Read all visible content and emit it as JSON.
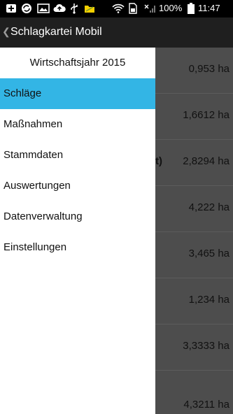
{
  "status_bar": {
    "icons": [
      "add-box-icon",
      "sync-icon",
      "image-icon",
      "cloud-upload-icon",
      "usb-icon",
      "folder-icon",
      "wifi-icon",
      "sim-icon",
      "signal-icon"
    ],
    "battery": "100%",
    "time": "11:47"
  },
  "action_bar": {
    "title": "Schlagkartei Mobil"
  },
  "drawer": {
    "fiscal_year": "Wirtschaftsjahr 2015",
    "items": [
      {
        "label": "Schläge",
        "active": true
      },
      {
        "label": "Maßnahmen",
        "active": false
      },
      {
        "label": "Stammdaten",
        "active": false
      },
      {
        "label": "Auswertungen",
        "active": false
      },
      {
        "label": "Datenverwaltung",
        "active": false
      },
      {
        "label": "Einstellungen",
        "active": false
      }
    ]
  },
  "list": {
    "rows": [
      {
        "area": "0,953 ha",
        "fragment": ""
      },
      {
        "area": "1,6612 ha",
        "fragment": ""
      },
      {
        "area": "2,8294 ha",
        "fragment": "t)"
      },
      {
        "area": "4,222 ha",
        "fragment": ""
      },
      {
        "area": "3,465 ha",
        "fragment": ""
      },
      {
        "area": "1,234 ha",
        "fragment": ""
      },
      {
        "area": "3,3333 ha",
        "fragment": ""
      },
      {
        "area": "4,3211 ha",
        "fragment": ""
      }
    ]
  },
  "colors": {
    "accent": "#33b5e5",
    "action_bar": "#1f1f1f",
    "overlay": "#4d4d4d"
  }
}
